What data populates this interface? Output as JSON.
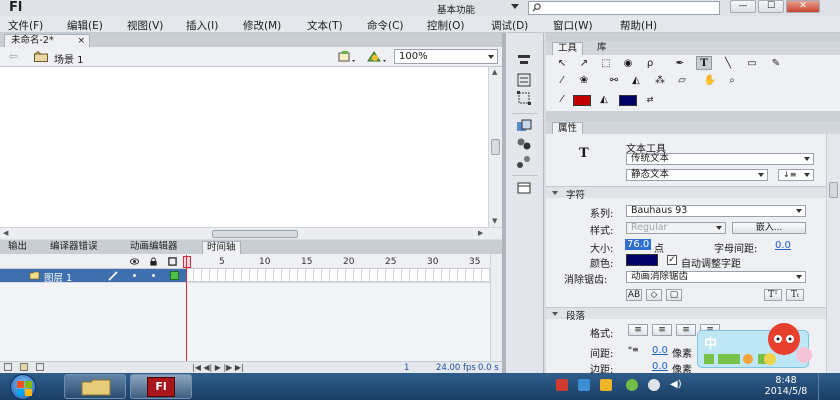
{
  "app": {
    "logo": "Fl",
    "workspace": "基本功能",
    "window_buttons": [
      "—",
      "☐",
      "✕"
    ]
  },
  "menu": [
    "文件(F)",
    "编辑(E)",
    "视图(V)",
    "插入(I)",
    "修改(M)",
    "文本(T)",
    "命令(C)",
    "控制(O)",
    "调试(D)",
    "窗口(W)",
    "帮助(H)"
  ],
  "document": {
    "tab_title": "未命名-2*",
    "tab_close": "×",
    "scene": "场景 1",
    "zoom": "100%"
  },
  "timeline": {
    "tabs": [
      "输出",
      "编译器错误",
      "动画编辑器",
      "时间轴"
    ],
    "active_tab": "时间轴",
    "frame_ticks": [
      "1",
      "5",
      "10",
      "15",
      "20",
      "25",
      "30",
      "35"
    ],
    "layer_name": "图层 1",
    "footer": {
      "frame": "1",
      "fps": "24.00 fps",
      "time": "0.0 s"
    }
  },
  "tools_panel": {
    "tabs": [
      "工具",
      "库"
    ],
    "active_tab": "工具",
    "stroke_color": "#c00000",
    "fill_color": "#000066"
  },
  "properties": {
    "tab": "属性",
    "tool_name": "文本工具",
    "text_engine": "传统文本",
    "text_type": "静态文本",
    "char_section": "字符",
    "family_label": "系列:",
    "family_value": "Bauhaus 93",
    "style_label": "样式:",
    "style_value": "Regular",
    "embed_button": "嵌入...",
    "size_label": "大小:",
    "size_value": "76.0",
    "size_unit": "点",
    "spacing_label": "字母间距:",
    "spacing_value": "0.0",
    "color_label": "颜色:",
    "text_color": "#000066",
    "auto_kern_label": "自动调整字距",
    "auto_kern_checked": true,
    "aa_label": "消除锯齿:",
    "aa_value": "动画消除锯齿",
    "para_section": "段落",
    "format_label": "格式:",
    "indent_label": "间距:",
    "indent_value": "0.0",
    "indent_unit": "像素",
    "margin_label": "边距:",
    "margin_value": "0.0",
    "margin_unit": "像素",
    "t_icon": "T"
  },
  "taskbar": {
    "time": "8:48",
    "date": "2014/5/8",
    "flash_label": "Fl",
    "ime_label": "中"
  }
}
